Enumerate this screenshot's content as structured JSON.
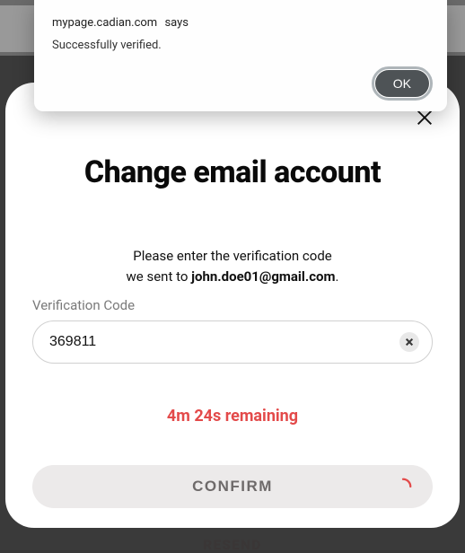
{
  "alert": {
    "host": "mypage.cadian.com",
    "says": "says",
    "message": "Successfully verified.",
    "ok_label": "OK"
  },
  "modal": {
    "title": "Change email account",
    "instruction_line1": "Please enter the verification code",
    "instruction_line2_prefix": "we sent to ",
    "email": "john.doe01@gmail.com",
    "instruction_line2_suffix": ".",
    "field_label": "Verification Code",
    "code_value": "369811",
    "timer_text": "4m 24s remaining",
    "confirm_label": "CONFIRM",
    "resend_label": "RESEND"
  },
  "colors": {
    "timer": "#e34a4a",
    "spinner": "#e34a4a"
  }
}
